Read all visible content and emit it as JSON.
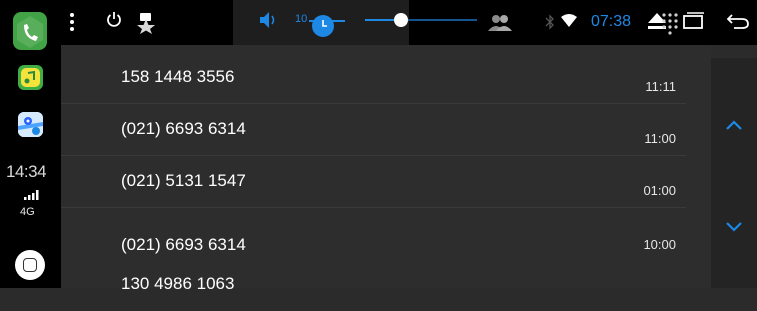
{
  "status_bar": {
    "volume_level": "10",
    "clock": "07:38",
    "volume_slider_fraction": 0.22,
    "brightness_slider_fraction": 0.28
  },
  "dock": {
    "time": "14:34",
    "network": "4G"
  },
  "call_log": [
    {
      "number": "158 1448 3556",
      "time": "11:11"
    },
    {
      "number": "(021) 6693 6314",
      "time": "11:00"
    },
    {
      "number": "(021) 5131 1547",
      "time": "01:00"
    },
    {
      "number": "(021) 6693 6314",
      "time": "10:00"
    },
    {
      "number": "130 4986 1063",
      "time": ""
    }
  ],
  "colors": {
    "accent": "#1e88e5",
    "phone_app": "#41a345",
    "background": "#2b2b2c"
  }
}
